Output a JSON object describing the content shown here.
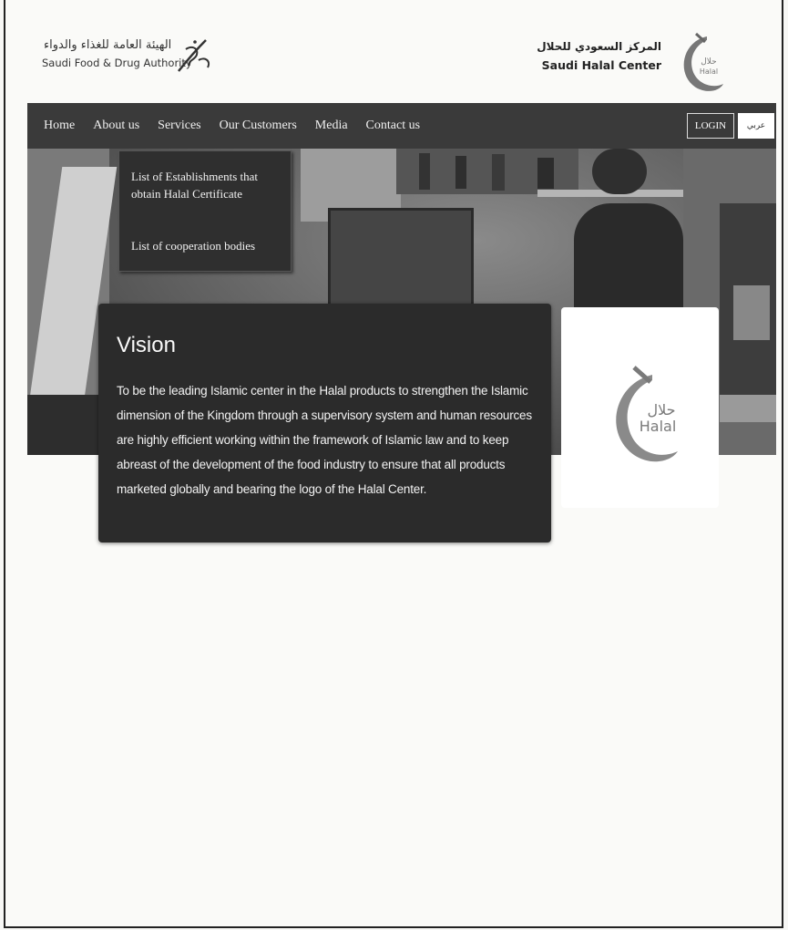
{
  "header": {
    "sfda_arabic": "الهيئة العامة للغذاء والدواء",
    "sfda_english": "Saudi Food & Drug Authority",
    "center_arabic": "المركز السعودي للحلال",
    "center_english": "Saudi Halal Center",
    "logo_arabic": "حلال",
    "logo_english": "Halal"
  },
  "nav": {
    "items": [
      {
        "label": "Home"
      },
      {
        "label": "About us"
      },
      {
        "label": "Services"
      },
      {
        "label": "Our Customers"
      },
      {
        "label": "Media"
      },
      {
        "label": "Contact us"
      }
    ],
    "login_label": "LOGIN",
    "lang_label": "عربي"
  },
  "dropdown": {
    "items": [
      {
        "label": "List of Establishments that obtain Halal Certificate"
      },
      {
        "label": "List of cooperation bodies"
      }
    ]
  },
  "vision": {
    "title": "Vision",
    "body": "To be the leading Islamic center in the Halal products to strengthen the Islamic dimension of the Kingdom through a supervisory system and human resources are highly efficient working within the framework of Islamic law and to keep abreast of the development of the food industry to ensure that all products marketed globally and bearing the logo of the Halal Center."
  },
  "halal_card": {
    "arabic": "حلال",
    "english": "Halal"
  },
  "colors": {
    "nav_bg": "#3a3a3a",
    "vision_bg": "#2b2b2b",
    "logo_gray": "#8a8a8a"
  }
}
